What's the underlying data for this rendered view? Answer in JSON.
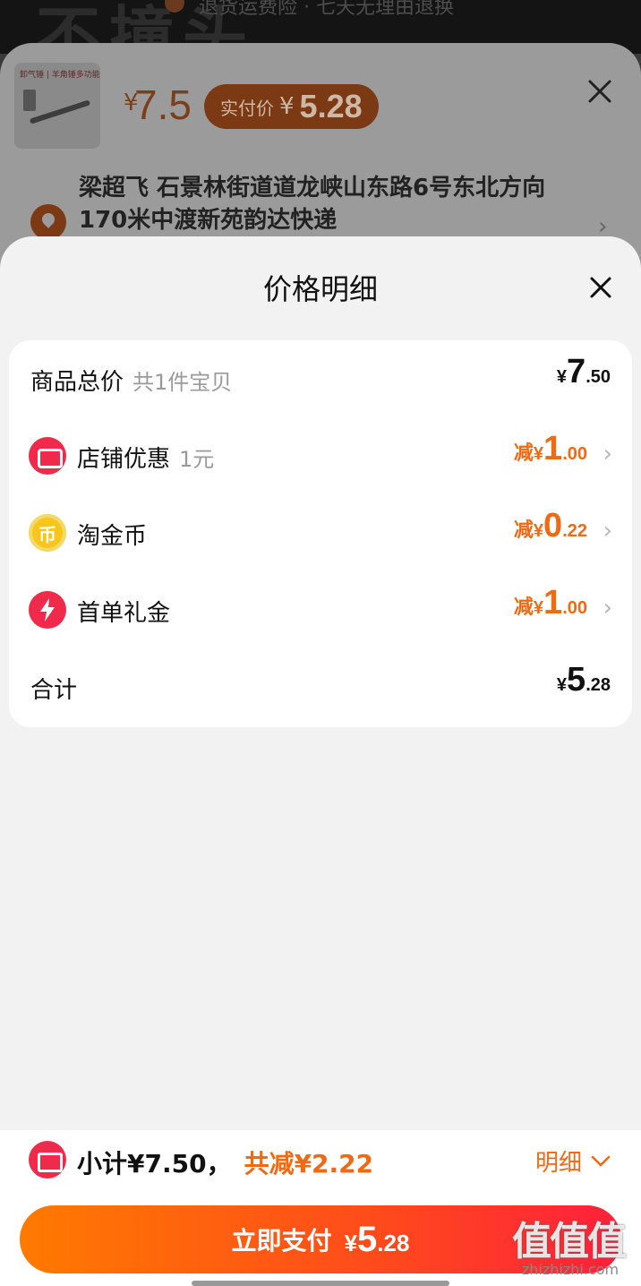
{
  "background": {
    "ghost_text": "不撞头",
    "ghost_line": "退货运费险 · 七天无理由退换"
  },
  "order_sheet": {
    "thumbnail_caption": "卸气锤 | 羊角锤多功能 铁锤",
    "price_currency": "¥",
    "price": "7.5",
    "paid_label": "实付价",
    "paid_currency": "¥",
    "paid_value": "5.28",
    "address": "梁超飞  石景林街道道龙峡山东路6号东北方向170米中渡新苑韵达快递"
  },
  "price_detail": {
    "title": "价格明细",
    "rows": [
      {
        "label": "商品总价",
        "sub": "共1件宝贝",
        "prefix": "",
        "currency": "¥",
        "int": "7",
        "dec": ".50"
      },
      {
        "label": "店铺优惠",
        "sub": "1元",
        "prefix": "减",
        "currency": "¥",
        "int": "1",
        "dec": ".00",
        "icon": "shop-coupon-icon"
      },
      {
        "label": "淘金币",
        "sub": "",
        "prefix": "减",
        "currency": "¥",
        "int": "0",
        "dec": ".22",
        "icon": "gold-coin-icon"
      },
      {
        "label": "首单礼金",
        "sub": "",
        "prefix": "减",
        "currency": "¥",
        "int": "1",
        "dec": ".00",
        "icon": "lightning-icon"
      },
      {
        "label": "合计",
        "sub": "",
        "prefix": "",
        "currency": "¥",
        "int": "5",
        "dec": ".28"
      }
    ]
  },
  "bottom_bar": {
    "subtotal": "小计¥7.50，",
    "reduced": "共减¥2.22",
    "detail_label": "明细",
    "pay_label": "立即支付",
    "pay_currency": "¥",
    "pay_int": "5",
    "pay_dec": ".28",
    "watermark": "值值值",
    "watermark_url": "zhizhizhi.com"
  },
  "colors": {
    "accent": "#f06a14",
    "brand_red": "#ef2a4a",
    "pay_gradient_start": "#ff7a00",
    "pay_gradient_end": "#ff1f3c"
  }
}
